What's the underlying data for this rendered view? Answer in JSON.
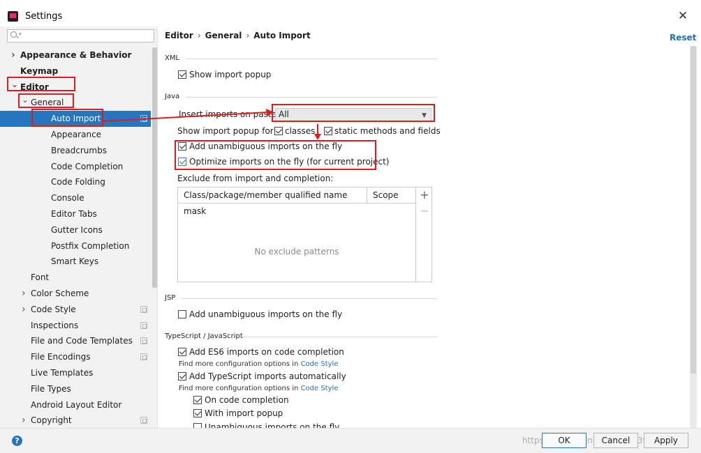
{
  "window": {
    "title": "Settings",
    "close_glyph": "✕"
  },
  "sidebar": {
    "search_placeholder": "",
    "items": [
      {
        "label": "Appearance & Behavior",
        "level": 0,
        "bold": true,
        "arrow": "right"
      },
      {
        "label": "Keymap",
        "level": 0,
        "bold": true,
        "arrow": ""
      },
      {
        "label": "Editor",
        "level": 0,
        "bold": true,
        "arrow": "down"
      },
      {
        "label": "General",
        "level": 1,
        "bold": false,
        "arrow": "down"
      },
      {
        "label": "Auto Import",
        "level": 2,
        "bold": false,
        "arrow": "",
        "selected": true,
        "project": true
      },
      {
        "label": "Appearance",
        "level": 2,
        "bold": false,
        "arrow": ""
      },
      {
        "label": "Breadcrumbs",
        "level": 2,
        "bold": false,
        "arrow": ""
      },
      {
        "label": "Code Completion",
        "level": 2,
        "bold": false,
        "arrow": ""
      },
      {
        "label": "Code Folding",
        "level": 2,
        "bold": false,
        "arrow": ""
      },
      {
        "label": "Console",
        "level": 2,
        "bold": false,
        "arrow": ""
      },
      {
        "label": "Editor Tabs",
        "level": 2,
        "bold": false,
        "arrow": ""
      },
      {
        "label": "Gutter Icons",
        "level": 2,
        "bold": false,
        "arrow": ""
      },
      {
        "label": "Postfix Completion",
        "level": 2,
        "bold": false,
        "arrow": ""
      },
      {
        "label": "Smart Keys",
        "level": 2,
        "bold": false,
        "arrow": ""
      },
      {
        "label": "Font",
        "level": 1,
        "bold": false,
        "arrow": ""
      },
      {
        "label": "Color Scheme",
        "level": 1,
        "bold": false,
        "arrow": "right"
      },
      {
        "label": "Code Style",
        "level": 1,
        "bold": false,
        "arrow": "right",
        "project": true
      },
      {
        "label": "Inspections",
        "level": 1,
        "bold": false,
        "arrow": "",
        "project": true
      },
      {
        "label": "File and Code Templates",
        "level": 1,
        "bold": false,
        "arrow": "",
        "project": true
      },
      {
        "label": "File Encodings",
        "level": 1,
        "bold": false,
        "arrow": "",
        "project": true
      },
      {
        "label": "Live Templates",
        "level": 1,
        "bold": false,
        "arrow": ""
      },
      {
        "label": "File Types",
        "level": 1,
        "bold": false,
        "arrow": ""
      },
      {
        "label": "Android Layout Editor",
        "level": 1,
        "bold": false,
        "arrow": ""
      },
      {
        "label": "Copyright",
        "level": 1,
        "bold": false,
        "arrow": "right",
        "project": true
      }
    ]
  },
  "content": {
    "breadcrumb": [
      "Editor",
      "General",
      "Auto Import"
    ],
    "breadcrumb_sep": "›",
    "reset_label": "Reset",
    "xml": {
      "section": "XML",
      "show_import_popup": {
        "label": "Show import popup",
        "checked": true
      }
    },
    "java": {
      "section": "Java",
      "insert_imports_label": "Insert imports on paste:",
      "insert_imports_value": "All",
      "show_popup_for_label": "Show import popup for:",
      "classes": {
        "label": "classes",
        "checked": true
      },
      "static_methods": {
        "label": "static methods and fields",
        "checked": true
      },
      "add_unambiguous": {
        "label": "Add unambiguous imports on the fly",
        "checked": true
      },
      "optimize_imports": {
        "label": "Optimize imports on the fly (for current project)",
        "checked": true
      },
      "exclude_label": "Exclude from import and completion:",
      "table": {
        "columns": [
          "Class/package/member qualified name mask",
          "Scope"
        ],
        "empty_text": "No exclude patterns",
        "add_glyph": "+",
        "remove_glyph": "−"
      }
    },
    "jsp": {
      "section": "JSP",
      "add_unambiguous": {
        "label": "Add unambiguous imports on the fly",
        "checked": false
      }
    },
    "ts": {
      "section": "TypeScript / JavaScript",
      "es6": {
        "label": "Add ES6 imports on code completion",
        "checked": true
      },
      "hint_prefix": "Find more configuration options in",
      "hint_link": "Code Style",
      "ts_auto": {
        "label": "Add TypeScript imports automatically",
        "checked": true
      },
      "on_completion": {
        "label": "On code completion",
        "checked": true
      },
      "with_popup": {
        "label": "With import popup",
        "checked": true
      },
      "unambiguous": {
        "label": "Unambiguous imports on the fly",
        "checked": false
      }
    }
  },
  "footer": {
    "help_glyph": "?",
    "ok_label": "OK",
    "cancel_label": "Cancel",
    "apply_label": "Apply",
    "watermark": "https://blog.csdn.net/qq_38396144"
  },
  "colors": {
    "selection": "#2675bf",
    "link": "#2470b3",
    "annotation": "#e01b1b"
  }
}
